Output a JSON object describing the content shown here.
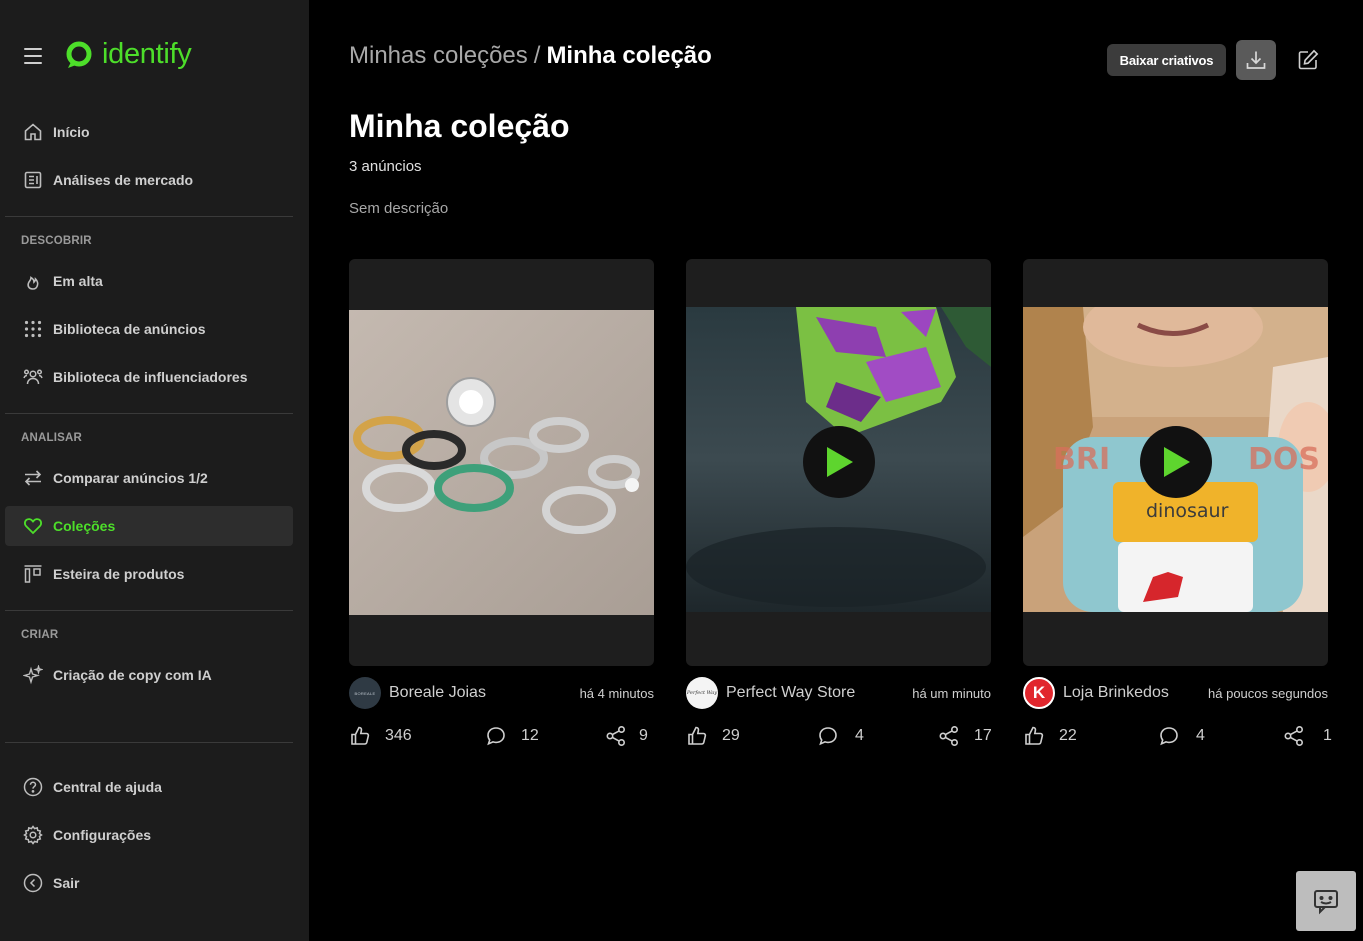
{
  "brand": {
    "name": "identify",
    "accent": "#4dde2a"
  },
  "sidebar": {
    "top_items": [
      {
        "label": "Início",
        "icon": "home-icon"
      },
      {
        "label": "Análises de mercado",
        "icon": "report-icon"
      }
    ],
    "sections": [
      {
        "title": "DESCOBRIR",
        "items": [
          {
            "label": "Em alta",
            "icon": "flame-icon"
          },
          {
            "label": "Biblioteca de anúncios",
            "icon": "grid-dots-icon"
          },
          {
            "label": "Biblioteca de influenciadores",
            "icon": "users-icon"
          }
        ]
      },
      {
        "title": "ANALISAR",
        "items": [
          {
            "label": "Comparar anúncios 1/2",
            "icon": "compare-arrows-icon"
          },
          {
            "label": "Coleções",
            "icon": "heart-icon",
            "active": true
          },
          {
            "label": "Esteira de produtos",
            "icon": "product-belt-icon"
          }
        ]
      },
      {
        "title": "CRIAR",
        "items": [
          {
            "label": "Criação de copy com IA",
            "icon": "sparkles-icon"
          }
        ]
      }
    ],
    "bottom_items": [
      {
        "label": "Central de ajuda",
        "icon": "help-icon"
      },
      {
        "label": "Configurações",
        "icon": "settings-icon"
      },
      {
        "label": "Sair",
        "icon": "logout-icon"
      }
    ]
  },
  "header": {
    "breadcrumb_parent": "Minhas coleções",
    "breadcrumb_separator": "/",
    "breadcrumb_current": "Minha coleção",
    "download_button": "Baixar criativos"
  },
  "collection": {
    "title": "Minha coleção",
    "count_text": "3 anúncios",
    "description": "Sem descrição"
  },
  "cards": [
    {
      "store": "Boreale Joias",
      "avatar_text": "BOREALE",
      "time": "há 4 minutos",
      "likes": "346",
      "comments": "12",
      "shares": "9",
      "media": "image"
    },
    {
      "store": "Perfect Way Store",
      "avatar_text": "Perfect Way",
      "time": "há um minuto",
      "likes": "29",
      "comments": "4",
      "shares": "17",
      "media": "video"
    },
    {
      "store": "Loja Brinkedos",
      "avatar_text": "K",
      "time": "há poucos segundos",
      "likes": "22",
      "comments": "4",
      "shares": "1",
      "media": "video",
      "video_caption": "dinosaur"
    }
  ]
}
